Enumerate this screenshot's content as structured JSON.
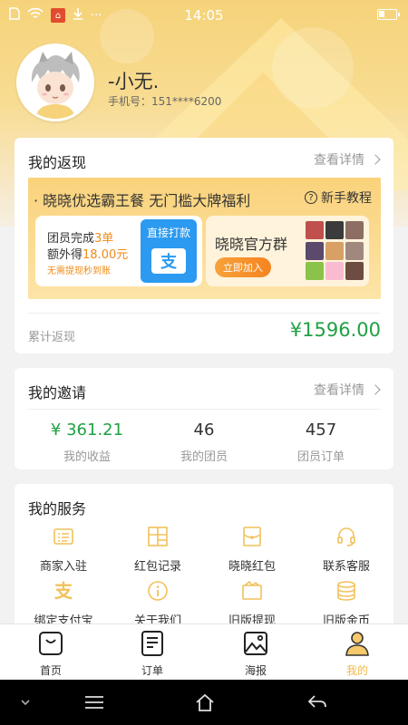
{
  "status_bar": {
    "time": "14:05",
    "icons": [
      "sim-icon",
      "wifi-icon",
      "app-notification-icon",
      "download-icon",
      "more-icon",
      "battery-icon"
    ],
    "more": "···"
  },
  "profile": {
    "username": "-小无.",
    "phone": "手机号：151****6200"
  },
  "cashback": {
    "title": "我的返现",
    "more": "查看详情",
    "banner_title": "· 晓晓优选霸王餐 无门槛大牌福利",
    "banner_help": "新手教程",
    "promo": {
      "line1_prefix": "团员完成",
      "line1_highlight": "3单",
      "line2_prefix": "额外得",
      "line2_highlight": "18.00元",
      "line3": "无需提现秒到账",
      "alipay_label": "直接打款",
      "alipay_logo": "支"
    },
    "group": {
      "title": "晓晓官方群",
      "join": "立即加入"
    },
    "total_label": "累计返现",
    "total_value": "¥1596.00"
  },
  "invite": {
    "title": "我的邀请",
    "more": "查看详情",
    "stats": [
      {
        "value": "¥ 361.21",
        "label": "我的收益"
      },
      {
        "value": "46",
        "label": "我的团员"
      },
      {
        "value": "457",
        "label": "团员订单"
      }
    ]
  },
  "services": {
    "title": "我的服务",
    "items": [
      {
        "label": "商家入驻",
        "icon": "merchant-icon"
      },
      {
        "label": "红包记录",
        "icon": "grid-icon"
      },
      {
        "label": "晓晓红包",
        "icon": "redpacket-icon"
      },
      {
        "label": "联系客服",
        "icon": "headset-icon"
      },
      {
        "label": "绑定支付宝",
        "icon": "alipay-icon"
      },
      {
        "label": "关于我们",
        "icon": "info-icon"
      },
      {
        "label": "旧版提现",
        "icon": "wallet-icon"
      },
      {
        "label": "旧版金币",
        "icon": "coins-icon"
      }
    ]
  },
  "tabbar": {
    "tabs": [
      {
        "label": "首页",
        "icon": "bag-icon"
      },
      {
        "label": "订单",
        "icon": "order-icon"
      },
      {
        "label": "海报",
        "icon": "image-icon"
      },
      {
        "label": "我的",
        "icon": "user-icon"
      }
    ],
    "active_color": "#f2b84b"
  },
  "colors": {
    "accent_green": "#21a044",
    "accent_orange": "#f08b1a",
    "header_yellow": "#f6d37a"
  }
}
